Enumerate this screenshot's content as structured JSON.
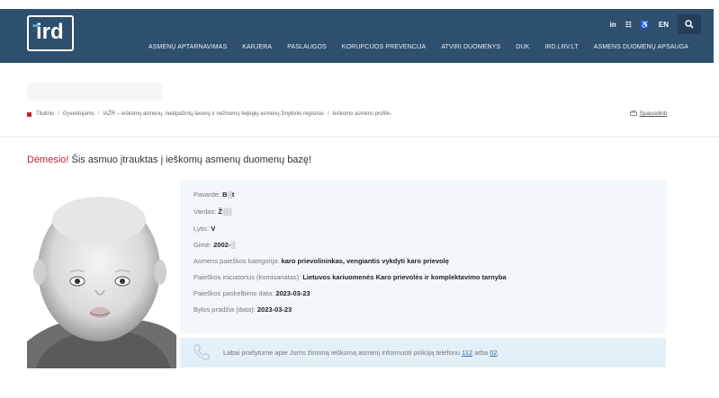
{
  "header": {
    "logo_text": "ird",
    "utils": {
      "linkedin": "in",
      "sitemap": "☷",
      "accessibility": "♿",
      "language": "EN"
    },
    "nav": [
      "ASMENŲ APTARNAVIMAS",
      "KARJERA",
      "PASLAUGOS",
      "KORUPCIJOS PREVENCIJA",
      "ATVIRI DUOMENYS",
      "DUK",
      "IRD.LRV.LT",
      "ASMENS DUOMENŲ APSAUGA"
    ]
  },
  "breadcrumb": {
    "items": [
      "Titulinis",
      "Gyventojams",
      "IAŽR – ieškomų asmenų, neatpažintų lavonų ir nežinomų bejėgių asmenų žinybinis registras",
      "Ieškomo asmens profilis"
    ],
    "print_label": "Spausdinti"
  },
  "title": {
    "warn": "Dėmesio!",
    "text": " Šis asmuo įtrauktas į ieškomų asmenų duomenų bazę!"
  },
  "profile": {
    "surname_label": "Pavardė:",
    "surname_value": "B░t",
    "name_label": "Vardas:",
    "name_value": "Ž░░",
    "gender_label": "Lytis:",
    "gender_value": "V",
    "birth_label": "Gimė:",
    "birth_value": "2002-░",
    "category_label": "Asmens paieškos kategorija:",
    "category_value": "karo prievolininkas, vengiantis vykdyti karo prievolę",
    "initiator_label": "Paieškos iniciatorius (komisariatas):",
    "initiator_value": "Lietuvos kariuomenės Karo prievolės ir komplektavimo tarnyba",
    "announced_label": "Paieškos paskelbimo data:",
    "announced_value": "2023-03-23",
    "case_label": "Bylos pradžia (data):",
    "case_value": "2023-03-23"
  },
  "callout": {
    "text": "Labai prašytume apie Jums žinomą ieškomą asmenį informuoti policiją telefonu ",
    "phone1": "112",
    "or": " arba ",
    "phone2": "02",
    "end": "."
  },
  "colors": {
    "header": "#2f4f6e",
    "accent": "#c0272d",
    "panel": "#f2f7fa",
    "callout": "#e3f0f7"
  }
}
